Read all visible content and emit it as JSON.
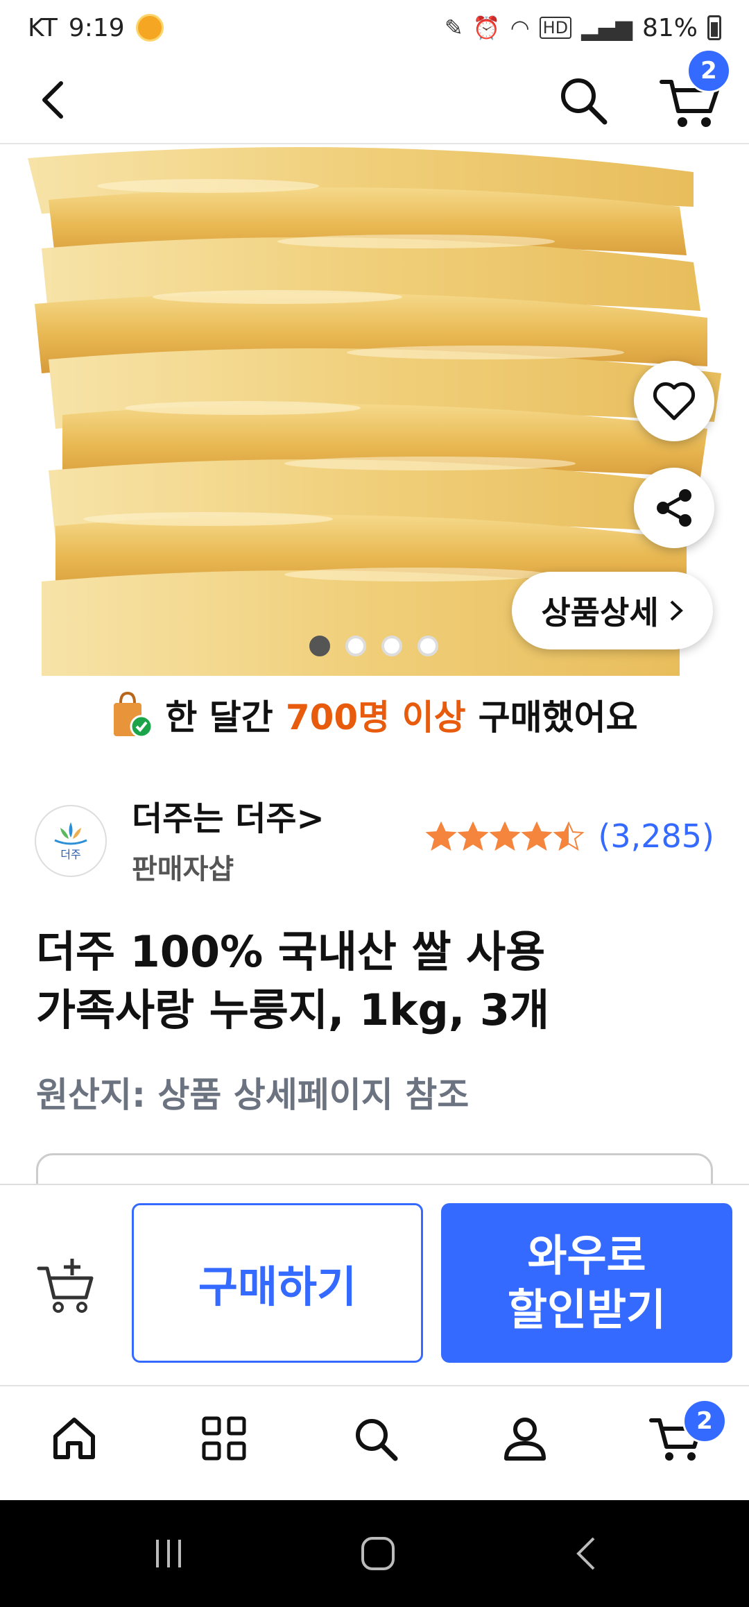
{
  "status_bar": {
    "carrier": "KT",
    "time": "9:19",
    "hd": "HD",
    "battery": "81%"
  },
  "header": {
    "cart_count": "2",
    "icons": [
      "back-arrow-icon",
      "search-icon",
      "cart-icon"
    ]
  },
  "hero": {
    "detail_button": "상품상세",
    "carousel": {
      "count": 4,
      "active_index": 0
    }
  },
  "notice": {
    "prefix": "한 달간",
    "highlight": "700명 이상",
    "suffix": "구매했어요",
    "highlight_color": "#e85a0c"
  },
  "seller": {
    "name": "더주는 더주>",
    "type": "판매자샵",
    "logo_text": "더주",
    "rating_stars": 4.5,
    "rating_count": "(3,285)"
  },
  "product": {
    "title_line1": "더주 100% 국내산 쌀 사용",
    "title_line2": "가족사랑 누룽지, 1kg, 3개",
    "origin": "원산지: 상품 상세페이지 참조"
  },
  "actions": {
    "buy_label": "구매하기",
    "wow_line1": "와우로",
    "wow_line2": "할인받기",
    "accent_color": "#346aff"
  },
  "bottom_nav": {
    "items": [
      "home-icon",
      "category-grid-icon",
      "search-icon",
      "my-account-icon",
      "cart-icon"
    ],
    "cart_count": "2"
  }
}
